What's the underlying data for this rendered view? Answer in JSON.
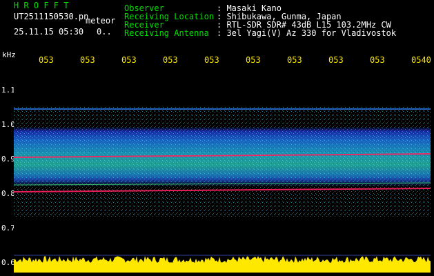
{
  "header": {
    "title": "H R O F F T",
    "filename": "UT2511150530.pn",
    "suffix": "meteor",
    "datetime": "25.11.15 05:30",
    "info": "0.."
  },
  "station": {
    "observer_label": "Observer",
    "observer_value": ": Masaki Kano",
    "location_label": "Receiving Location",
    "location_value": ": Shibukawa, Gunma, Japan",
    "receiver_label": "Receiver",
    "receiver_value": ": RTL-SDR SDR# 43dB L15 103.2MHz CW",
    "antenna_label": "Receiving Antenna",
    "antenna_value": ": 3el Yagi(V) Az 330 for Vladivostok"
  },
  "axis": {
    "y_unit": "kHz",
    "y_ticks": [
      "1.1",
      "1.0",
      "0.9",
      "0.8",
      "0.7",
      "0.6"
    ],
    "x_ticks": [
      "053",
      "053",
      "053",
      "053",
      "053",
      "053",
      "053",
      "053",
      "053",
      "0540"
    ]
  },
  "colors": {
    "header_text": "#00e000",
    "station_text": "#ffffff",
    "tick_text": "#ffe800",
    "signal_band": "#ff2060",
    "noise_floor": "#ffe800"
  }
}
